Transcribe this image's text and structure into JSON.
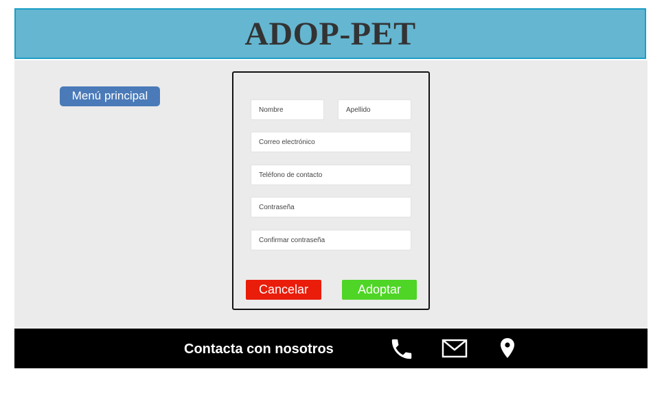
{
  "header": {
    "title": "ADOP-PET"
  },
  "sidebar": {
    "menu_label": "Menú principal"
  },
  "form": {
    "fields": {
      "nombre": {
        "placeholder": "Nombre",
        "value": ""
      },
      "apellido": {
        "placeholder": "Apellido",
        "value": ""
      },
      "correo": {
        "placeholder": "Correo electrónico",
        "value": ""
      },
      "telefono": {
        "placeholder": "Teléfono de contacto",
        "value": ""
      },
      "contrasena": {
        "placeholder": "Contraseña",
        "value": ""
      },
      "confirmar": {
        "placeholder": "Confirmar contraseña",
        "value": ""
      }
    },
    "cancel_label": "Cancelar",
    "submit_label": "Adoptar"
  },
  "footer": {
    "contact_label": "Contacta con nosotros",
    "icons": [
      "phone-icon",
      "mail-icon",
      "location-icon"
    ]
  },
  "colors": {
    "header_bg": "#65b6d1",
    "header_border": "#1a9ec6",
    "menu_button": "#4a7ab8",
    "cancel_button": "#ea1c0a",
    "submit_button": "#4ed526",
    "footer_bg": "#000000",
    "content_bg": "#ebebeb"
  }
}
